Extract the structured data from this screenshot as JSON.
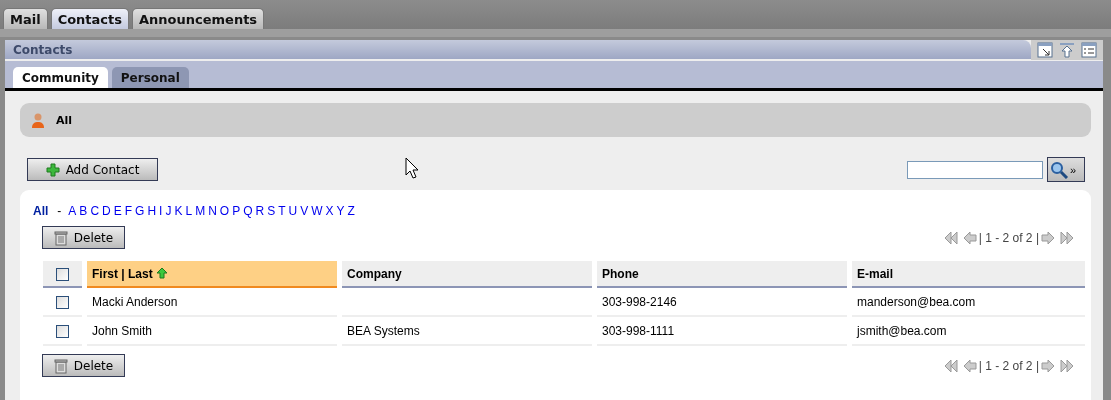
{
  "top_tabs": [
    {
      "label": "Mail",
      "selected": false
    },
    {
      "label": "Contacts",
      "selected": true
    },
    {
      "label": "Announcements",
      "selected": false
    }
  ],
  "portlet": {
    "title": "Contacts"
  },
  "sub_tabs": [
    {
      "label": "Community",
      "selected": true
    },
    {
      "label": "Personal",
      "selected": false
    }
  ],
  "group": {
    "label": "All"
  },
  "add_button": "Add Contact",
  "search_button": "»",
  "letters": [
    {
      "label": "All",
      "selected": true
    },
    {
      "label": "A",
      "selected": false
    },
    {
      "label": "B",
      "selected": false
    },
    {
      "label": "C",
      "selected": false
    },
    {
      "label": "D",
      "selected": false
    },
    {
      "label": "E",
      "selected": false
    },
    {
      "label": "F",
      "selected": false
    },
    {
      "label": "G",
      "selected": false
    },
    {
      "label": "H",
      "selected": false
    },
    {
      "label": "I",
      "selected": false
    },
    {
      "label": "J",
      "selected": false
    },
    {
      "label": "K",
      "selected": false
    },
    {
      "label": "L",
      "selected": false
    },
    {
      "label": "M",
      "selected": false
    },
    {
      "label": "N",
      "selected": false
    },
    {
      "label": "O",
      "selected": false
    },
    {
      "label": "P",
      "selected": false
    },
    {
      "label": "Q",
      "selected": false
    },
    {
      "label": "R",
      "selected": false
    },
    {
      "label": "S",
      "selected": false
    },
    {
      "label": "T",
      "selected": false
    },
    {
      "label": "U",
      "selected": false
    },
    {
      "label": "V",
      "selected": false
    },
    {
      "label": "W",
      "selected": false
    },
    {
      "label": "X",
      "selected": false
    },
    {
      "label": "Y",
      "selected": false
    },
    {
      "label": "Z",
      "selected": false
    }
  ],
  "letters_separator": "-",
  "delete_buttons": [
    "Delete",
    "Delete"
  ],
  "pagers": [
    "| 1 - 2 of 2 |",
    "| 1 - 2 of 2 |"
  ],
  "table": {
    "select_all": {
      "checked": false
    },
    "columns": [
      {
        "label": "First | Last",
        "sorted": true
      },
      {
        "label": "Company",
        "sorted": false
      },
      {
        "label": "Phone",
        "sorted": false
      },
      {
        "label": "E-mail",
        "sorted": false
      }
    ],
    "rows": [
      {
        "checked": false,
        "cells": [
          "Macki Anderson",
          "",
          "303-998-2146",
          "manderson@bea.com"
        ]
      },
      {
        "checked": false,
        "cells": [
          "John Smith",
          "BEA Systems",
          "303-998-1111",
          "jsmith@bea.com"
        ]
      }
    ]
  }
}
